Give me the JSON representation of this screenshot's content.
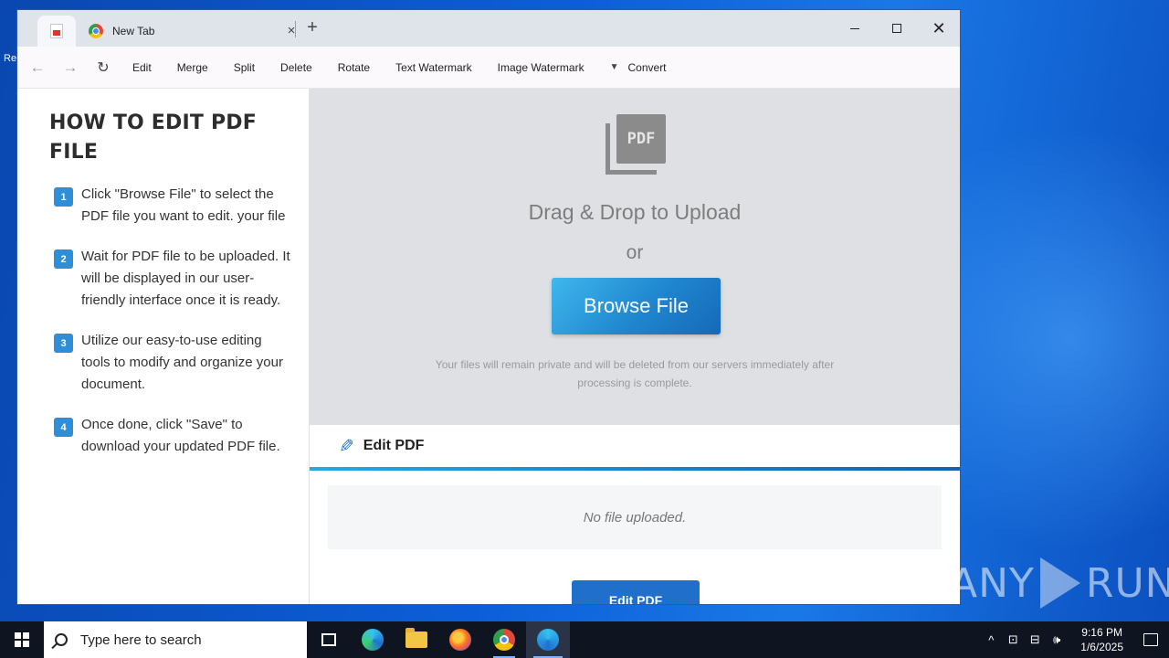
{
  "browser": {
    "tabs": [
      {
        "title": ""
      },
      {
        "title": "New Tab"
      }
    ],
    "new_tab_symbol": "+",
    "tab_close_symbol": "×"
  },
  "toolbar": {
    "back_symbol": "←",
    "forward_symbol": "→",
    "reload_symbol": "↻",
    "menu": [
      "Edit",
      "Merge",
      "Split",
      "Delete",
      "Rotate",
      "Text Watermark",
      "Image Watermark"
    ],
    "caret_symbol": "▼",
    "convert_label": "Convert"
  },
  "sidebar": {
    "title": "HOW TO EDIT PDF FILE",
    "steps": [
      {
        "num": "1",
        "text": "Click \"Browse File\" to select the PDF file you want to edit. your file"
      },
      {
        "num": "2",
        "text": "Wait for PDF file to be uploaded. It will be displayed in our user-friendly interface once it is ready."
      },
      {
        "num": "3",
        "text": "Utilize our easy-to-use editing tools to modify and organize your document."
      },
      {
        "num": "4",
        "text": "Once done, click \"Save\" to download your updated PDF file."
      }
    ]
  },
  "upload": {
    "icon_text": "PDF",
    "drag_text": "Drag & Drop to Upload",
    "or_text": "or",
    "browse_label": "Browse File",
    "privacy_text": "Your files will remain private and will be deleted from our servers immediately after processing is complete."
  },
  "editor": {
    "header": "Edit PDF",
    "status": "No file uploaded.",
    "edit_button": "Edit PDF"
  },
  "taskbar": {
    "search_placeholder": "Type here to search",
    "time": "9:16 PM",
    "date": "1/6/2025"
  },
  "watermark": {
    "left": "ANY",
    "right": "RUN"
  },
  "colors": {
    "accent": "#2f8ed8",
    "browse_gradient_start": "#3fb7ec",
    "browse_gradient_end": "#1669b8",
    "edit_button": "#1f6fcb"
  }
}
